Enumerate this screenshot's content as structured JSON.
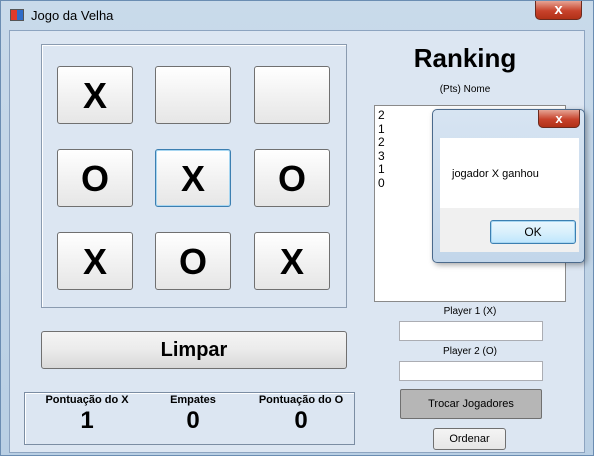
{
  "window": {
    "title": "Jogo da Velha",
    "close_glyph": "x"
  },
  "board": {
    "cells": [
      "X",
      "",
      "",
      "O",
      "X",
      "O",
      "X",
      "O",
      "X"
    ]
  },
  "clear_button": "Limpar",
  "score": {
    "x_label": "Pontuação do X",
    "x_value": "1",
    "draws_label": "Empates",
    "draws_value": "0",
    "o_label": "Pontuação do O",
    "o_value": "0"
  },
  "ranking": {
    "title": "Ranking",
    "subtitle": "(Pts) Nome",
    "entries": [
      "2",
      "1",
      "2",
      "3",
      "1",
      "0"
    ]
  },
  "players": {
    "player1_label": "Player 1 (X)",
    "player1_value": "",
    "player2_label": "Player 2 (O)",
    "player2_value": ""
  },
  "swap_button": "Trocar Jogadores",
  "order_button": "Ordenar",
  "message_box": {
    "text": "jogador X ganhou",
    "ok": "OK",
    "close_glyph": "x"
  }
}
